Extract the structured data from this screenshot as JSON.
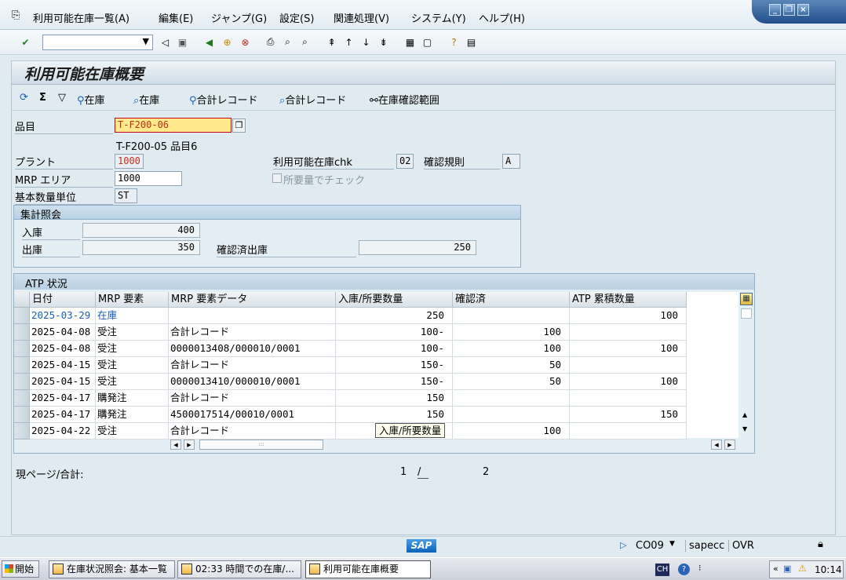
{
  "menu": {
    "items": [
      "利用可能在庫一覧(A)",
      "編集(E)",
      "ジャンプ(G)",
      "設定(S)",
      "関連処理(V)",
      "システム(Y)",
      "ヘルプ(H)"
    ]
  },
  "toolbar": {
    "command_value": ""
  },
  "screen": {
    "title": "利用可能在庫概要"
  },
  "app_toolbar": {
    "btn_stock1": "在庫",
    "btn_stock2": "在庫",
    "btn_total1": "合計レコード",
    "btn_total2": "合計レコード",
    "btn_scope": "在庫確認範囲"
  },
  "form": {
    "material_label": "品目",
    "material_value": "T-F200-06",
    "material_desc": "T-F200-05 品目6",
    "plant_label": "プラント",
    "plant_value": "1000",
    "mrp_area_label": "MRP エリア",
    "mrp_area_value": "1000",
    "uom_label": "基本数量単位",
    "uom_value": "ST",
    "atp_chk_label": "利用可能在庫chk",
    "atp_chk_value": "02",
    "rule_label": "確認規則",
    "rule_value": "A",
    "req_check_label": "所要量でチェック"
  },
  "summary": {
    "title": "集計照会",
    "receipt_label": "入庫",
    "receipt_value": "400",
    "issue_label": "出庫",
    "issue_value": "350",
    "confirmed_issue_label": "確認済出庫",
    "confirmed_issue_value": "250"
  },
  "atp": {
    "title": "ATP 状況",
    "headers": [
      "日付",
      "MRP 要素",
      "MRP 要素データ",
      "入庫/所要数量",
      "確認済",
      "ATP 累積数量"
    ],
    "rows": [
      [
        "2025-03-29",
        "在庫",
        "",
        "250",
        "",
        "100"
      ],
      [
        "2025-04-08",
        "受注",
        "合計レコード",
        "100-",
        "100",
        ""
      ],
      [
        "2025-04-08",
        "受注",
        "0000013408/000010/0001",
        "100-",
        "100",
        "100"
      ],
      [
        "2025-04-15",
        "受注",
        "合計レコード",
        "150-",
        "50",
        ""
      ],
      [
        "2025-04-15",
        "受注",
        "0000013410/000010/0001",
        "150-",
        "50",
        "100"
      ],
      [
        "2025-04-17",
        "購発注",
        "合計レコード",
        "150",
        "",
        ""
      ],
      [
        "2025-04-17",
        "購発注",
        "4500017514/00010/0001",
        "150",
        "",
        "150"
      ],
      [
        "2025-04-22",
        "受注",
        "合計レコード",
        "",
        "100",
        ""
      ]
    ],
    "tooltip": "入庫/所要数量"
  },
  "paging": {
    "label": "現ページ/合計:",
    "current": "1",
    "sep": "/",
    "total": "2"
  },
  "status": {
    "brand": "SAP",
    "tcode": "CO09",
    "server": "sapecc",
    "mode": "OVR"
  },
  "taskbar": {
    "start": "開始",
    "tasks": [
      "在庫状況照会: 基本一覧",
      "02:33 時間での在庫/...",
      "利用可能在庫概要"
    ],
    "lang": "CH",
    "time": "10:14"
  },
  "colors": {
    "link_blue": "#1a5fb4",
    "yellow_field": "#ffe98a"
  }
}
